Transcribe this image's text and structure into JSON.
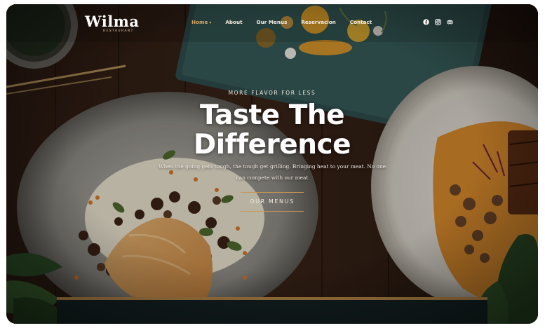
{
  "brand": {
    "name": "Wilma",
    "tagline": "RESTAURANT"
  },
  "nav": {
    "items": [
      {
        "label": "Home",
        "active": true
      },
      {
        "label": "About",
        "active": false
      },
      {
        "label": "Our Menus",
        "active": false
      },
      {
        "label": "Reservacion",
        "active": false
      },
      {
        "label": "Contact",
        "active": false
      }
    ],
    "social": [
      "facebook-icon",
      "instagram-icon",
      "tripadvisor-icon"
    ]
  },
  "hero": {
    "eyebrow": "MORE FLAVOR FOR LESS",
    "title_line1": "Taste The",
    "title_line2": "Difference",
    "description_line1": "When the going gets tough, the tough get grilling. Bringing heat to your meat. No one",
    "description_line2": "can compete with our meat",
    "cta_label": "OUR MENUS"
  },
  "colors": {
    "accent": "#d7a866",
    "text": "#ffffff",
    "background": "#2a1b12"
  }
}
